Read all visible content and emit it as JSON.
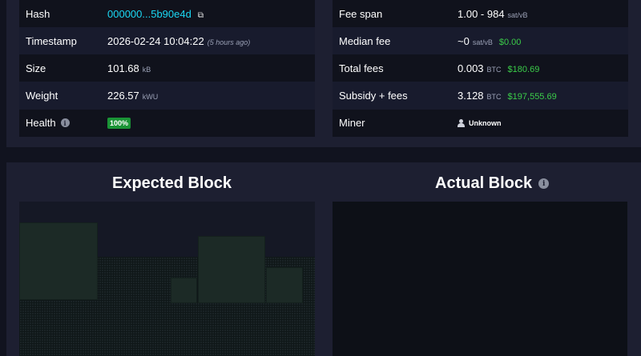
{
  "left_table": {
    "hash_label": "Hash",
    "hash_value": "000000...5b90e4d",
    "timestamp_label": "Timestamp",
    "timestamp_value": "2026-02-24 10:04:22",
    "timestamp_ago": "(5 hours ago)",
    "size_label": "Size",
    "size_value": "101.68",
    "size_unit": "kB",
    "weight_label": "Weight",
    "weight_value": "226.57",
    "weight_unit": "kWU",
    "health_label": "Health",
    "health_value": "100%"
  },
  "right_table": {
    "fee_span_label": "Fee span",
    "fee_span_value": "1.00 - 984",
    "fee_span_unit": "sat/vB",
    "median_fee_label": "Median fee",
    "median_fee_value": "~0",
    "median_fee_unit": "sat/vB",
    "median_fee_usd": "$0.00",
    "total_fees_label": "Total fees",
    "total_fees_value": "0.003",
    "total_fees_unit": "BTC",
    "total_fees_usd": "$180.69",
    "subsidy_label": "Subsidy + fees",
    "subsidy_value": "3.128",
    "subsidy_unit": "BTC",
    "subsidy_usd": "$197,555.69",
    "miner_label": "Miner",
    "miner_value": "Unknown"
  },
  "blocks": {
    "expected_title": "Expected Block",
    "actual_title": "Actual Block"
  },
  "icons": {
    "info": "info-icon",
    "copy": "copy-icon",
    "miner": "person-icon"
  },
  "colors": {
    "link": "#1bd8f4",
    "fiat_green": "#3bcc49",
    "health_badge": "#1a9436"
  }
}
